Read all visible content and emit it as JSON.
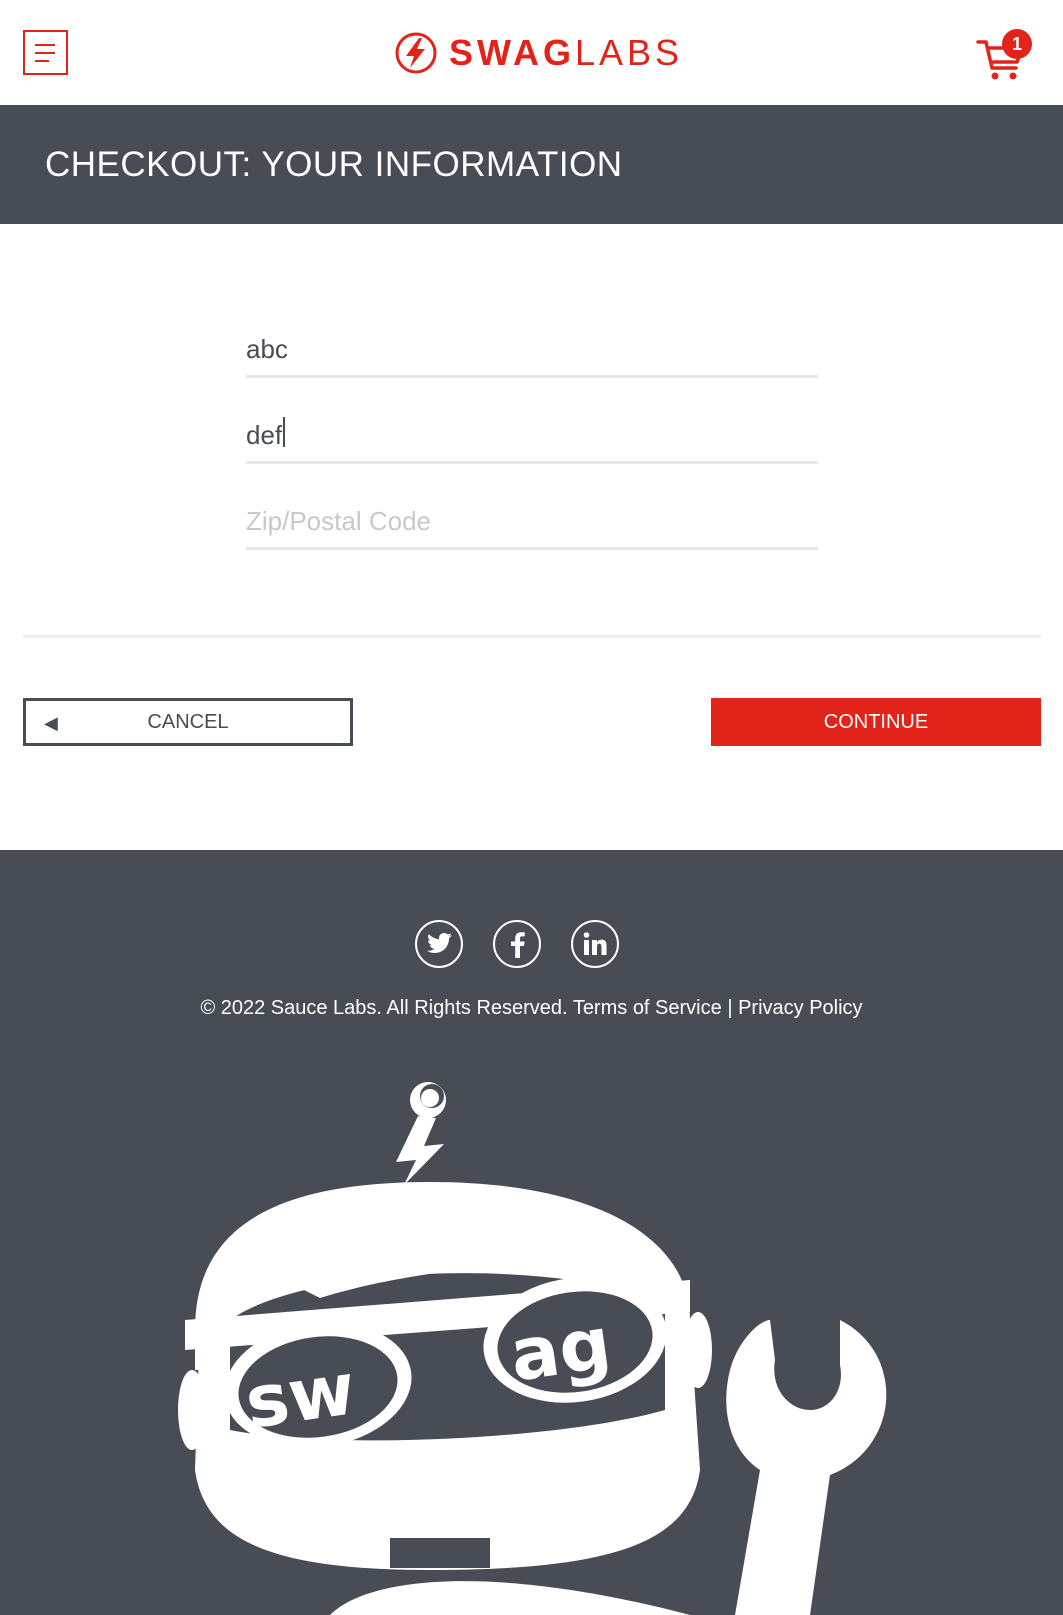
{
  "header": {
    "brand_bold": "SWAG",
    "brand_thin": "LABS",
    "cart_count": "1"
  },
  "page": {
    "title": "CHECKOUT: YOUR INFORMATION"
  },
  "form": {
    "first_name_value": "abc",
    "last_name_value": "def",
    "zip_placeholder": "Zip/Postal Code",
    "zip_value": ""
  },
  "actions": {
    "cancel_label": "CANCEL",
    "continue_label": "CONTINUE"
  },
  "footer": {
    "copyright": "© 2022 Sauce Labs. All Rights Reserved.",
    "terms": "Terms of Service",
    "separator": "|",
    "privacy": "Privacy Policy",
    "mascot_lettering": "swag"
  },
  "colors": {
    "brand_red": "#e2231a",
    "dark_gray": "#474c55",
    "footer_bg": "#474c55"
  }
}
